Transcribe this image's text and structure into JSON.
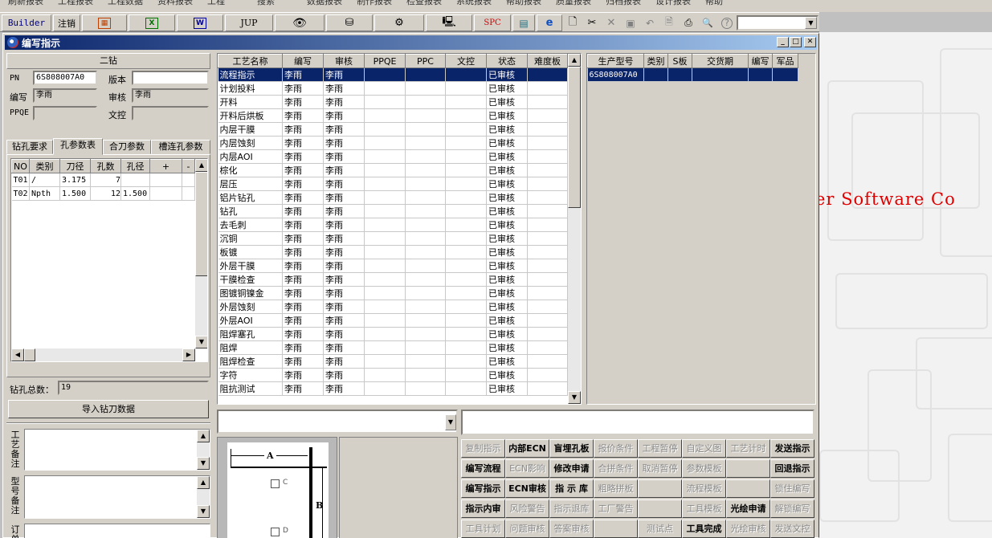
{
  "menu": [
    "刷新报表",
    "工程报表",
    "工程数据",
    "资料报表",
    "工程",
    "搜索",
    "数据报表",
    "制作报表",
    "检查报表",
    "系统报表",
    "帮助报表",
    "质量报表",
    "归档报表",
    "设计报表",
    "帮助"
  ],
  "toolbar": {
    "builder_label": "Builder",
    "logout_label": "注销",
    "jup_label": "JUP",
    "spc_label": "SPC",
    "icons": [
      "calendar-icon",
      "excel-icon",
      "word-icon",
      "eye-icon",
      "database-icon",
      "network-icon",
      "computer-icon",
      "calculator-icon",
      "ie-icon",
      "new-icon",
      "cut-icon",
      "close-icon",
      "save-icon",
      "undo-icon",
      "preview-icon",
      "print-icon",
      "find-icon",
      "help-icon"
    ]
  },
  "window": {
    "title": "编写指示"
  },
  "left": {
    "header": "二钻",
    "pn_label": "PN",
    "pn_value": "6S808007A0",
    "version_label": "版本",
    "version_value": "",
    "editor_label": "编写",
    "editor_value": "李雨",
    "reviewer_label": "审核",
    "reviewer_value": "李雨",
    "ppqe_label": "PPQE",
    "ppqe_value": "",
    "doc_ctrl_label": "文控",
    "doc_ctrl_value": "",
    "tabs": [
      "钻孔要求",
      "孔参数表",
      "合刀参数",
      "槽连孔参数"
    ],
    "active_tab": 1,
    "drill_columns": [
      "NO",
      "类别",
      "刀径",
      "孔数",
      "孔径",
      "+",
      "-"
    ],
    "drill_rows": [
      [
        "T01",
        "/",
        "3.175",
        "7",
        "",
        "",
        ""
      ],
      [
        "T02",
        "Npth",
        "1.500",
        "12",
        "1.500",
        "",
        ""
      ]
    ],
    "total_label": "钻孔总数：",
    "total_value": "19",
    "import_button": "导入钻刀数据",
    "notes": [
      {
        "label": "工艺备注",
        "value": ""
      },
      {
        "label": "型号备注",
        "value": ""
      },
      {
        "label": "订单备注",
        "value": ""
      }
    ]
  },
  "process_table": {
    "columns": [
      "工艺名称",
      "编写",
      "审核",
      "PPQE",
      "PPC",
      "文控",
      "状态",
      "难度板"
    ],
    "rows": [
      [
        "流程指示",
        "李雨",
        "李雨",
        "",
        "",
        "",
        "已审核",
        ""
      ],
      [
        "计划投料",
        "李雨",
        "李雨",
        "",
        "",
        "",
        "已审核",
        ""
      ],
      [
        "开料",
        "李雨",
        "李雨",
        "",
        "",
        "",
        "已审核",
        ""
      ],
      [
        "开料后烘板",
        "李雨",
        "李雨",
        "",
        "",
        "",
        "已审核",
        ""
      ],
      [
        "内层干膜",
        "李雨",
        "李雨",
        "",
        "",
        "",
        "已审核",
        ""
      ],
      [
        "内层蚀刻",
        "李雨",
        "李雨",
        "",
        "",
        "",
        "已审核",
        ""
      ],
      [
        "内层AOI",
        "李雨",
        "李雨",
        "",
        "",
        "",
        "已审核",
        ""
      ],
      [
        "棕化",
        "李雨",
        "李雨",
        "",
        "",
        "",
        "已审核",
        ""
      ],
      [
        "层压",
        "李雨",
        "李雨",
        "",
        "",
        "",
        "已审核",
        ""
      ],
      [
        "铝片钻孔",
        "李雨",
        "李雨",
        "",
        "",
        "",
        "已审核",
        ""
      ],
      [
        "钻孔",
        "李雨",
        "李雨",
        "",
        "",
        "",
        "已审核",
        ""
      ],
      [
        "去毛刺",
        "李雨",
        "李雨",
        "",
        "",
        "",
        "已审核",
        ""
      ],
      [
        "沉铜",
        "李雨",
        "李雨",
        "",
        "",
        "",
        "已审核",
        ""
      ],
      [
        "板镀",
        "李雨",
        "李雨",
        "",
        "",
        "",
        "已审核",
        ""
      ],
      [
        "外层干膜",
        "李雨",
        "李雨",
        "",
        "",
        "",
        "已审核",
        ""
      ],
      [
        "干膜检查",
        "李雨",
        "李雨",
        "",
        "",
        "",
        "已审核",
        ""
      ],
      [
        "图镀铜镍金",
        "李雨",
        "李雨",
        "",
        "",
        "",
        "已审核",
        ""
      ],
      [
        "外层蚀刻",
        "李雨",
        "李雨",
        "",
        "",
        "",
        "已审核",
        ""
      ],
      [
        "外层AOI",
        "李雨",
        "李雨",
        "",
        "",
        "",
        "已审核",
        ""
      ],
      [
        "阻焊塞孔",
        "李雨",
        "李雨",
        "",
        "",
        "",
        "已审核",
        ""
      ],
      [
        "阻焊",
        "李雨",
        "李雨",
        "",
        "",
        "",
        "已审核",
        ""
      ],
      [
        "阻焊检查",
        "李雨",
        "李雨",
        "",
        "",
        "",
        "已审核",
        ""
      ],
      [
        "字符",
        "李雨",
        "李雨",
        "",
        "",
        "",
        "已审核",
        ""
      ],
      [
        "阻抗测试",
        "李雨",
        "李雨",
        "",
        "",
        "",
        "已审核",
        ""
      ]
    ],
    "selected_row": 0
  },
  "product_table": {
    "columns": [
      "生产型号",
      "类别",
      "S板",
      "交货期",
      "编写",
      "军品"
    ],
    "rows": [
      [
        "6S808007A0",
        "",
        "",
        "",
        "",
        ""
      ]
    ]
  },
  "diagram": {
    "label_a": "A",
    "label_b": "B",
    "label_c": "C",
    "label_d": "D"
  },
  "actions": [
    [
      {
        "t": "复制指示",
        "d": true
      },
      {
        "t": "内部ECN",
        "d": false
      },
      {
        "t": "盲埋孔板",
        "d": false
      },
      {
        "t": "报价条件",
        "d": true
      },
      {
        "t": "工程暂停",
        "d": true
      },
      {
        "t": "自定义图",
        "d": true
      },
      {
        "t": "工艺计时",
        "d": true
      },
      {
        "t": "发送指示",
        "d": false
      }
    ],
    [
      {
        "t": "编写流程",
        "d": false
      },
      {
        "t": "ECN影响",
        "d": true
      },
      {
        "t": "修改申请",
        "d": false
      },
      {
        "t": "合拼条件",
        "d": true
      },
      {
        "t": "取消暂停",
        "d": true
      },
      {
        "t": "参数模板",
        "d": true
      },
      {
        "t": "",
        "d": true
      },
      {
        "t": "回退指示",
        "d": false
      }
    ],
    [
      {
        "t": "编写指示",
        "d": false
      },
      {
        "t": "ECN审核",
        "d": false
      },
      {
        "t": "指 示 库",
        "d": false
      },
      {
        "t": "粗略拼板",
        "d": true
      },
      {
        "t": "",
        "d": true
      },
      {
        "t": "流程模板",
        "d": true
      },
      {
        "t": "",
        "d": true
      },
      {
        "t": "锁住编写",
        "d": true
      }
    ],
    [
      {
        "t": "指示内审",
        "d": false
      },
      {
        "t": "风险警告",
        "d": true
      },
      {
        "t": "指示退库",
        "d": true
      },
      {
        "t": "工厂警告",
        "d": true
      },
      {
        "t": "",
        "d": true
      },
      {
        "t": "工具模板",
        "d": true
      },
      {
        "t": "光绘申请",
        "d": false
      },
      {
        "t": "解锁编写",
        "d": true
      }
    ],
    [
      {
        "t": "工具计划",
        "d": true
      },
      {
        "t": "问题审核",
        "d": true
      },
      {
        "t": "答案审核",
        "d": true
      },
      {
        "t": "",
        "d": true
      },
      {
        "t": "测试点",
        "d": true
      },
      {
        "t": "工具完成",
        "d": false
      },
      {
        "t": "光绘审核",
        "d": true
      },
      {
        "t": "发送文控",
        "d": true
      }
    ]
  ],
  "desktop_text": "er Software Co"
}
